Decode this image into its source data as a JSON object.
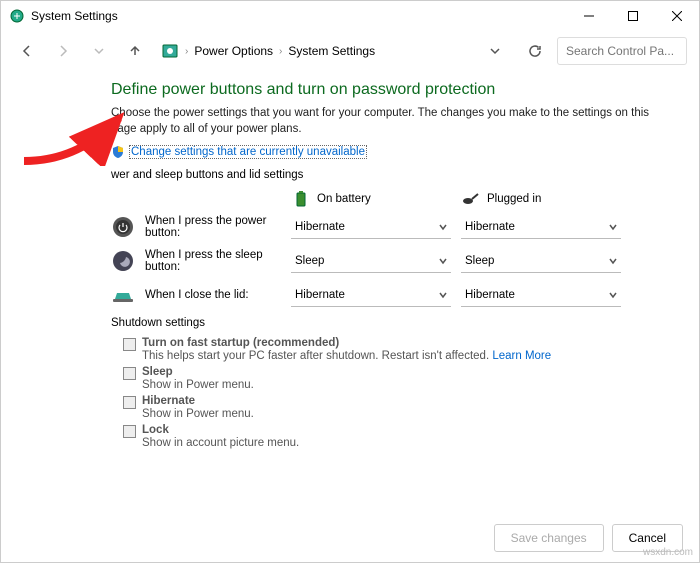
{
  "window": {
    "title": "System Settings"
  },
  "breadcrumb": {
    "item1": "Power Options",
    "item2": "System Settings"
  },
  "search": {
    "placeholder": "Search Control Pa..."
  },
  "heading": "Define power buttons and turn on password protection",
  "desc": "Choose the power settings that you want for your computer. The changes you make to the settings on this page apply to all of your power plans.",
  "changeLink": "Change settings that are currently unavailable",
  "section1": "wer and sleep buttons and lid settings",
  "cols": {
    "battery": "On battery",
    "plugged": "Plugged in"
  },
  "rows": {
    "power": {
      "label": "When I press the power button:",
      "battery": "Hibernate",
      "plugged": "Hibernate"
    },
    "sleep": {
      "label": "When I press the sleep button:",
      "battery": "Sleep",
      "plugged": "Sleep"
    },
    "lid": {
      "label": "When I close the lid:",
      "battery": "Hibernate",
      "plugged": "Hibernate"
    }
  },
  "section2": "Shutdown settings",
  "opts": {
    "fast": {
      "title": "Turn on fast startup (recommended)",
      "sub": "This helps start your PC faster after shutdown. Restart isn't affected. ",
      "lm": "Learn More"
    },
    "sleep": {
      "title": "Sleep",
      "sub": "Show in Power menu."
    },
    "hib": {
      "title": "Hibernate",
      "sub": "Show in Power menu."
    },
    "lock": {
      "title": "Lock",
      "sub": "Show in account picture menu."
    }
  },
  "buttons": {
    "save": "Save changes",
    "cancel": "Cancel"
  },
  "watermark": "wsxdn.com"
}
